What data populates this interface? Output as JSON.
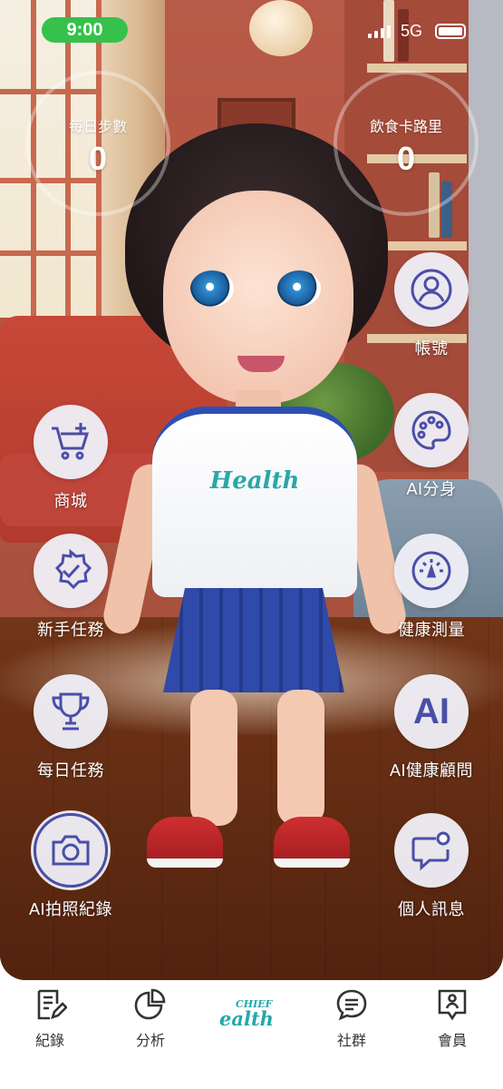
{
  "status_bar": {
    "time": "9:00",
    "network": "5G"
  },
  "stats": {
    "steps": {
      "label": "每日步數",
      "value": "0"
    },
    "calories": {
      "label": "飲食卡路里",
      "value": "0"
    }
  },
  "actions": {
    "account": {
      "label": "帳號",
      "icon": "user-icon"
    },
    "shop": {
      "label": "商城",
      "icon": "cart-plus-icon"
    },
    "ai_avatar": {
      "label": "AI分身",
      "icon": "palette-icon"
    },
    "newbie_tasks": {
      "label": "新手任務",
      "icon": "badge-check-icon"
    },
    "health_measure": {
      "label": "健康測量",
      "icon": "gauge-icon"
    },
    "daily_tasks": {
      "label": "每日任務",
      "icon": "trophy-icon"
    },
    "ai_advisor": {
      "label": "AI健康顧問",
      "icon_text": "AI"
    },
    "photo_record": {
      "label": "AI拍照紀錄",
      "icon": "camera-icon"
    },
    "messages": {
      "label": "個人訊息",
      "icon": "chat-notification-icon"
    }
  },
  "avatar": {
    "shirt_logo": "Health"
  },
  "tabbar": {
    "records": "紀錄",
    "analysis": "分析",
    "brand_top": "CHIEF",
    "brand_main": "ealth",
    "community": "社群",
    "member": "會員"
  },
  "colors": {
    "accent": "#4a4ea8",
    "status_pill": "#35c14b",
    "brand": "#22a9ad"
  }
}
